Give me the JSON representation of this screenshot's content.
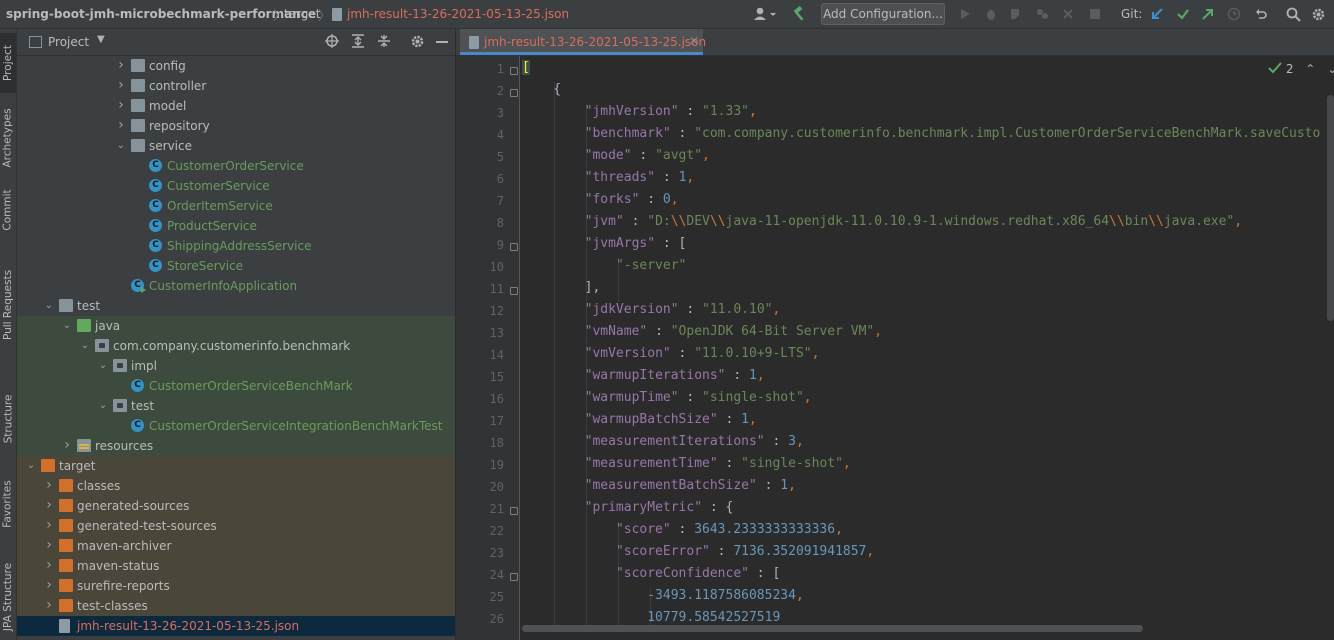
{
  "breadcrumbs": [
    "spring-boot-jmh-microbechmark-performance",
    "target",
    "jmh-result-13-26-2021-05-13-25.json"
  ],
  "toolbar": {
    "add_configuration": "Add Configuration...",
    "git_label": "Git:"
  },
  "left_strip_tabs": [
    "Project",
    "Archetypes",
    "Commit",
    "Pull Requests",
    "Structure",
    "Favorites",
    "JPA Structure"
  ],
  "project_panel": {
    "title": "Project",
    "tree": [
      {
        "label": "config",
        "type": "folder",
        "depth": 6
      },
      {
        "label": "controller",
        "type": "folder",
        "depth": 6
      },
      {
        "label": "model",
        "type": "folder",
        "depth": 6
      },
      {
        "label": "repository",
        "type": "folder",
        "depth": 6
      },
      {
        "label": "service",
        "type": "folder",
        "depth": 6,
        "expanded": true
      },
      {
        "label": "CustomerOrderService",
        "type": "class",
        "depth": 7
      },
      {
        "label": "CustomerService",
        "type": "class",
        "depth": 7
      },
      {
        "label": "OrderItemService",
        "type": "class",
        "depth": 7
      },
      {
        "label": "ProductService",
        "type": "class",
        "depth": 7
      },
      {
        "label": "ShippingAddressService",
        "type": "class",
        "depth": 7
      },
      {
        "label": "StoreService",
        "type": "class",
        "depth": 7
      },
      {
        "label": "CustomerInfoApplication",
        "type": "class-run",
        "depth": 6
      },
      {
        "label": "test",
        "type": "folder",
        "depth": 2,
        "expanded": true
      },
      {
        "label": "java",
        "type": "folder-green",
        "depth": 3,
        "expanded": true,
        "tint": "green"
      },
      {
        "label": "com.company.customerinfo.benchmark",
        "type": "package",
        "depth": 4,
        "expanded": true,
        "tint": "green"
      },
      {
        "label": "impl",
        "type": "package",
        "depth": 5,
        "expanded": true,
        "tint": "green"
      },
      {
        "label": "CustomerOrderServiceBenchMark",
        "type": "class",
        "depth": 6,
        "tint": "green"
      },
      {
        "label": "test",
        "type": "package",
        "depth": 5,
        "expanded": true,
        "tint": "green"
      },
      {
        "label": "CustomerOrderServiceIntegrationBenchMarkTest",
        "type": "class",
        "depth": 6,
        "tint": "green"
      },
      {
        "label": "resources",
        "type": "resources",
        "depth": 3,
        "tint": "green"
      },
      {
        "label": "target",
        "type": "folder-orange",
        "depth": 1,
        "expanded": true,
        "tint": "orange"
      },
      {
        "label": "classes",
        "type": "folder-orange",
        "depth": 2,
        "tint": "orange"
      },
      {
        "label": "generated-sources",
        "type": "folder-orange",
        "depth": 2,
        "tint": "orange"
      },
      {
        "label": "generated-test-sources",
        "type": "folder-orange",
        "depth": 2,
        "tint": "orange"
      },
      {
        "label": "maven-archiver",
        "type": "folder-orange",
        "depth": 2,
        "tint": "orange"
      },
      {
        "label": "maven-status",
        "type": "folder-orange",
        "depth": 2,
        "tint": "orange"
      },
      {
        "label": "surefire-reports",
        "type": "folder-orange",
        "depth": 2,
        "tint": "orange"
      },
      {
        "label": "test-classes",
        "type": "folder-orange",
        "depth": 2,
        "tint": "orange"
      },
      {
        "label": "jmh-result-13-26-2021-05-13-25.json",
        "type": "json",
        "depth": 2,
        "selected": true
      }
    ]
  },
  "editor": {
    "tab_title": "jmh-result-13-26-2021-05-13-25.json",
    "inspection_count": "2",
    "line_numbers": [
      "1",
      "2",
      "3",
      "4",
      "5",
      "6",
      "7",
      "8",
      "9",
      "10",
      "11",
      "12",
      "13",
      "14",
      "15",
      "16",
      "17",
      "18",
      "19",
      "20",
      "21",
      "22",
      "23",
      "24",
      "25",
      "26"
    ],
    "lines": [
      [
        {
          "t": "[",
          "c": "bracket-hl"
        }
      ],
      [
        {
          "t": "    {",
          "c": ""
        }
      ],
      [
        {
          "t": "        ",
          "c": ""
        },
        {
          "t": "\"jmhVersion\"",
          "c": "k"
        },
        {
          "t": " : ",
          "c": ""
        },
        {
          "t": "\"1.33\"",
          "c": "s"
        },
        {
          "t": ",",
          "c": "p"
        }
      ],
      [
        {
          "t": "        ",
          "c": ""
        },
        {
          "t": "\"benchmark\"",
          "c": "k"
        },
        {
          "t": " : ",
          "c": ""
        },
        {
          "t": "\"com.company.customerinfo.benchmark.impl.CustomerOrderServiceBenchMark.saveCusto",
          "c": "s"
        }
      ],
      [
        {
          "t": "        ",
          "c": ""
        },
        {
          "t": "\"mode\"",
          "c": "k"
        },
        {
          "t": " : ",
          "c": ""
        },
        {
          "t": "\"avgt\"",
          "c": "s"
        },
        {
          "t": ",",
          "c": "p"
        }
      ],
      [
        {
          "t": "        ",
          "c": ""
        },
        {
          "t": "\"threads\"",
          "c": "k"
        },
        {
          "t": " : ",
          "c": ""
        },
        {
          "t": "1",
          "c": "n"
        },
        {
          "t": ",",
          "c": "p"
        }
      ],
      [
        {
          "t": "        ",
          "c": ""
        },
        {
          "t": "\"forks\"",
          "c": "k"
        },
        {
          "t": " : ",
          "c": ""
        },
        {
          "t": "0",
          "c": "n"
        },
        {
          "t": ",",
          "c": "p"
        }
      ],
      [
        {
          "t": "        ",
          "c": ""
        },
        {
          "t": "\"jvm\"",
          "c": "k"
        },
        {
          "t": " : ",
          "c": ""
        },
        {
          "t": "\"D:",
          "c": "s"
        },
        {
          "t": "\\\\",
          "c": "p"
        },
        {
          "t": "DEV",
          "c": "s"
        },
        {
          "t": "\\\\",
          "c": "p"
        },
        {
          "t": "java-11-openjdk-11.0.10.9-1.windows.redhat.x86_64",
          "c": "s"
        },
        {
          "t": "\\\\",
          "c": "p"
        },
        {
          "t": "bin",
          "c": "s"
        },
        {
          "t": "\\\\",
          "c": "p"
        },
        {
          "t": "java.exe\"",
          "c": "s"
        },
        {
          "t": ",",
          "c": "p"
        }
      ],
      [
        {
          "t": "        ",
          "c": ""
        },
        {
          "t": "\"jvmArgs\"",
          "c": "k"
        },
        {
          "t": " : [",
          "c": ""
        }
      ],
      [
        {
          "t": "            ",
          "c": ""
        },
        {
          "t": "\"-server\"",
          "c": "s"
        }
      ],
      [
        {
          "t": "        ],",
          "c": ""
        }
      ],
      [
        {
          "t": "        ",
          "c": ""
        },
        {
          "t": "\"jdkVersion\"",
          "c": "k"
        },
        {
          "t": " : ",
          "c": ""
        },
        {
          "t": "\"11.0.10\"",
          "c": "s"
        },
        {
          "t": ",",
          "c": "p"
        }
      ],
      [
        {
          "t": "        ",
          "c": ""
        },
        {
          "t": "\"vmName\"",
          "c": "k"
        },
        {
          "t": " : ",
          "c": ""
        },
        {
          "t": "\"OpenJDK 64-Bit Server VM\"",
          "c": "s"
        },
        {
          "t": ",",
          "c": "p"
        }
      ],
      [
        {
          "t": "        ",
          "c": ""
        },
        {
          "t": "\"vmVersion\"",
          "c": "k"
        },
        {
          "t": " : ",
          "c": ""
        },
        {
          "t": "\"11.0.10+9-LTS\"",
          "c": "s"
        },
        {
          "t": ",",
          "c": "p"
        }
      ],
      [
        {
          "t": "        ",
          "c": ""
        },
        {
          "t": "\"warmupIterations\"",
          "c": "k"
        },
        {
          "t": " : ",
          "c": ""
        },
        {
          "t": "1",
          "c": "n"
        },
        {
          "t": ",",
          "c": "p"
        }
      ],
      [
        {
          "t": "        ",
          "c": ""
        },
        {
          "t": "\"warmupTime\"",
          "c": "k"
        },
        {
          "t": " : ",
          "c": ""
        },
        {
          "t": "\"single-shot\"",
          "c": "s"
        },
        {
          "t": ",",
          "c": "p"
        }
      ],
      [
        {
          "t": "        ",
          "c": ""
        },
        {
          "t": "\"warmupBatchSize\"",
          "c": "k"
        },
        {
          "t": " : ",
          "c": ""
        },
        {
          "t": "1",
          "c": "n"
        },
        {
          "t": ",",
          "c": "p"
        }
      ],
      [
        {
          "t": "        ",
          "c": ""
        },
        {
          "t": "\"measurementIterations\"",
          "c": "k"
        },
        {
          "t": " : ",
          "c": ""
        },
        {
          "t": "3",
          "c": "n"
        },
        {
          "t": ",",
          "c": "p"
        }
      ],
      [
        {
          "t": "        ",
          "c": ""
        },
        {
          "t": "\"measurementTime\"",
          "c": "k"
        },
        {
          "t": " : ",
          "c": ""
        },
        {
          "t": "\"single-shot\"",
          "c": "s"
        },
        {
          "t": ",",
          "c": "p"
        }
      ],
      [
        {
          "t": "        ",
          "c": ""
        },
        {
          "t": "\"measurementBatchSize\"",
          "c": "k"
        },
        {
          "t": " : ",
          "c": ""
        },
        {
          "t": "1",
          "c": "n"
        },
        {
          "t": ",",
          "c": "p"
        }
      ],
      [
        {
          "t": "        ",
          "c": ""
        },
        {
          "t": "\"primaryMetric\"",
          "c": "k"
        },
        {
          "t": " : {",
          "c": ""
        }
      ],
      [
        {
          "t": "            ",
          "c": ""
        },
        {
          "t": "\"score\"",
          "c": "k"
        },
        {
          "t": " : ",
          "c": ""
        },
        {
          "t": "3643.2333333333336",
          "c": "n"
        },
        {
          "t": ",",
          "c": "p"
        }
      ],
      [
        {
          "t": "            ",
          "c": ""
        },
        {
          "t": "\"scoreError\"",
          "c": "k"
        },
        {
          "t": " : ",
          "c": ""
        },
        {
          "t": "7136.352091941857",
          "c": "n"
        },
        {
          "t": ",",
          "c": "p"
        }
      ],
      [
        {
          "t": "            ",
          "c": ""
        },
        {
          "t": "\"scoreConfidence\"",
          "c": "k"
        },
        {
          "t": " : [",
          "c": ""
        }
      ],
      [
        {
          "t": "                ",
          "c": ""
        },
        {
          "t": "-3493.1187586085234",
          "c": "n"
        },
        {
          "t": ",",
          "c": "p"
        }
      ],
      [
        {
          "t": "                ",
          "c": ""
        },
        {
          "t": "10779.58542527519",
          "c": "n"
        }
      ]
    ]
  }
}
